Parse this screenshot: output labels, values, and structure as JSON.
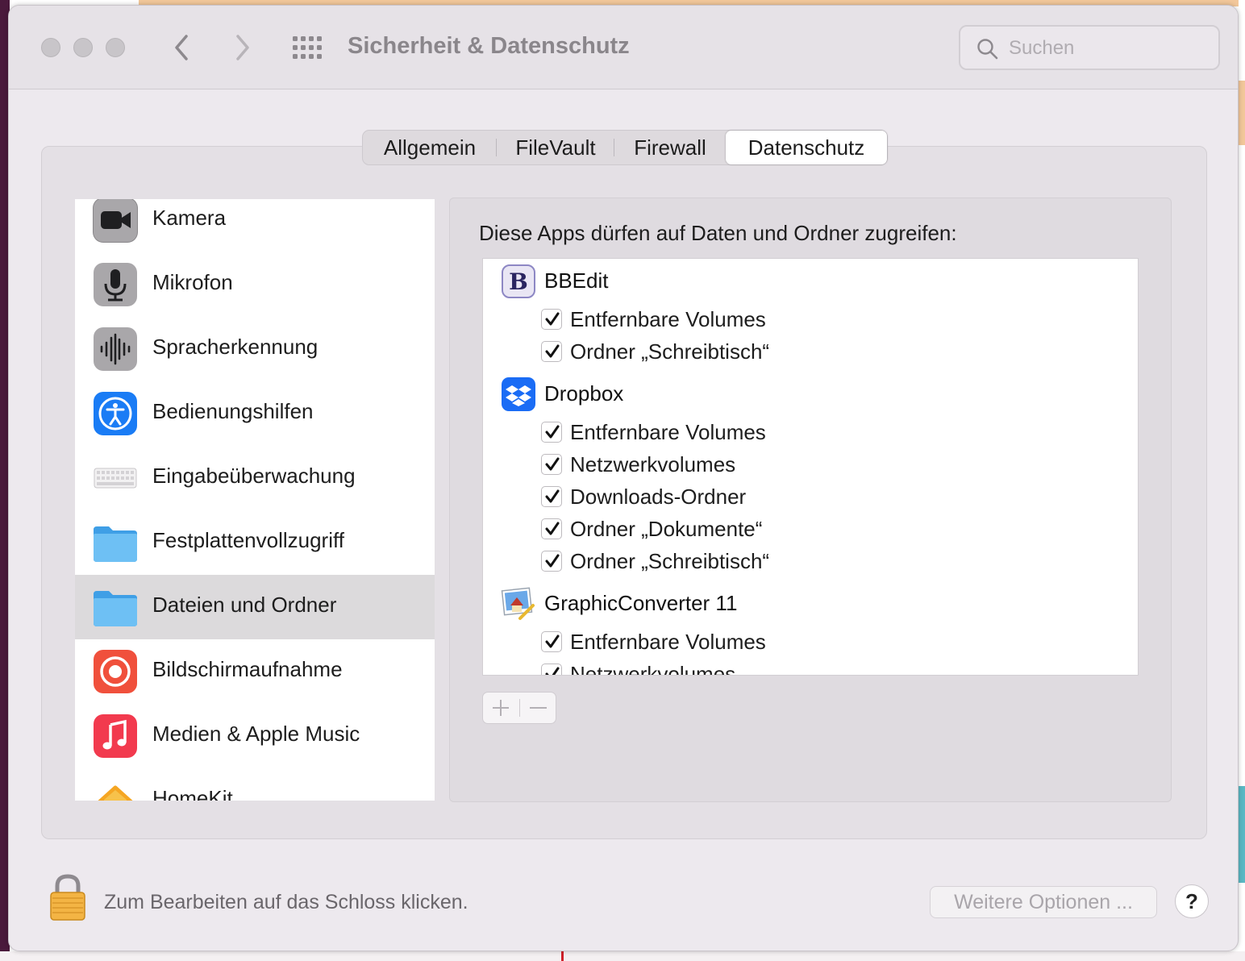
{
  "window": {
    "title": "Sicherheit & Datenschutz",
    "search_placeholder": "Suchen"
  },
  "tabs": [
    {
      "label": "Allgemein",
      "active": false
    },
    {
      "label": "FileVault",
      "active": false
    },
    {
      "label": "Firewall",
      "active": false
    },
    {
      "label": "Datenschutz",
      "active": true
    }
  ],
  "sidebar": {
    "items": [
      {
        "label": "Kamera",
        "icon": "camera-icon"
      },
      {
        "label": "Mikrofon",
        "icon": "microphone-icon"
      },
      {
        "label": "Spracherkennung",
        "icon": "waveform-icon"
      },
      {
        "label": "Bedienungshilfen",
        "icon": "accessibility-icon"
      },
      {
        "label": "Eingabeüberwachung",
        "icon": "keyboard-icon"
      },
      {
        "label": "Festplattenvollzugriff",
        "icon": "folder-icon"
      },
      {
        "label": "Dateien und Ordner",
        "icon": "folder-icon",
        "selected": true
      },
      {
        "label": "Bildschirmaufnahme",
        "icon": "screen-record-icon"
      },
      {
        "label": "Medien & Apple Music",
        "icon": "music-icon"
      },
      {
        "label": "HomeKit",
        "icon": "home-icon"
      }
    ]
  },
  "main": {
    "heading": "Diese Apps dürfen auf Daten und Ordner zugreifen:",
    "apps": [
      {
        "name": "BBEdit",
        "icon": "bbedit-icon",
        "permissions": [
          {
            "label": "Entfernbare Volumes",
            "checked": true
          },
          {
            "label": "Ordner „Schreibtisch“",
            "checked": true
          }
        ]
      },
      {
        "name": "Dropbox",
        "icon": "dropbox-icon",
        "permissions": [
          {
            "label": "Entfernbare Volumes",
            "checked": true
          },
          {
            "label": "Netzwerkvolumes",
            "checked": true
          },
          {
            "label": "Downloads-Ordner",
            "checked": true
          },
          {
            "label": "Ordner „Dokumente“",
            "checked": true
          },
          {
            "label": "Ordner „Schreibtisch“",
            "checked": true
          }
        ]
      },
      {
        "name": "GraphicConverter 11",
        "icon": "graphicconverter-icon",
        "permissions": [
          {
            "label": "Entfernbare Volumes",
            "checked": true
          },
          {
            "label": "Netzwerkvolumes",
            "checked": true
          }
        ]
      }
    ],
    "add_label": "+",
    "remove_label": "−"
  },
  "footer": {
    "lock_text": "Zum Bearbeiten auf das Schloss klicken.",
    "more_options": "Weitere Optionen ...",
    "help": "?"
  },
  "colors": {
    "accent_blue": "#1a7cf5",
    "folder_blue": "#5fb4f0",
    "record_red": "#f0503c",
    "music_red": "#f23a4e"
  }
}
